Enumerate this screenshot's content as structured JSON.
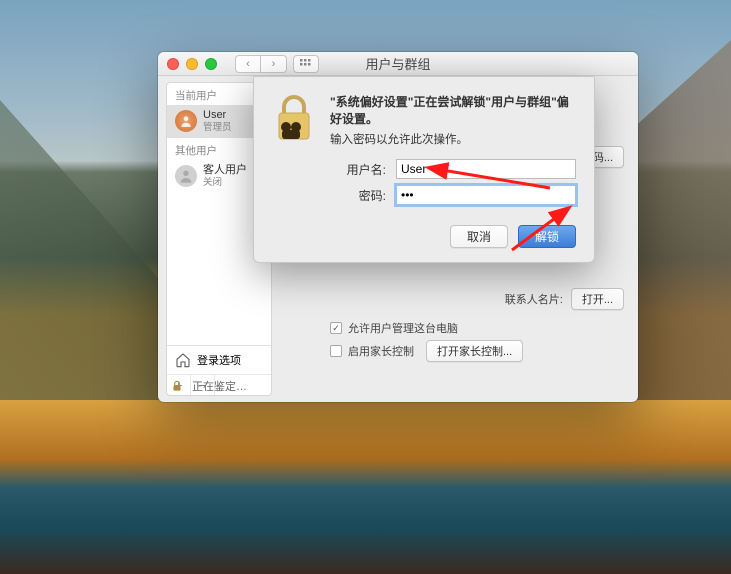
{
  "window": {
    "title": "用户与群组",
    "change_password_btn": "改密码...",
    "contact_card_label": "联系人名片:",
    "open_btn": "打开...",
    "allow_admin_label": "允许用户管理这台电脑",
    "parental_enable_label": "启用家长控制",
    "parental_open_btn": "打开家长控制...",
    "lock_status": "正在鉴定…"
  },
  "sidebar": {
    "current_user_header": "当前用户",
    "other_users_header": "其他用户",
    "items": [
      {
        "name": "User",
        "role": "管理员"
      },
      {
        "name": "客人用户",
        "role": "关闭"
      }
    ],
    "login_options": "登录选项",
    "plus": "+",
    "minus": "−"
  },
  "sheet": {
    "headline": "\"系统偏好设置\"正在尝试解锁\"用户与群组\"偏好设置。",
    "subline": "输入密码以允许此次操作。",
    "username_label": "用户名:",
    "username_value": "User",
    "password_label": "密码:",
    "password_value": "•••",
    "cancel_btn": "取消",
    "unlock_btn": "解锁"
  }
}
